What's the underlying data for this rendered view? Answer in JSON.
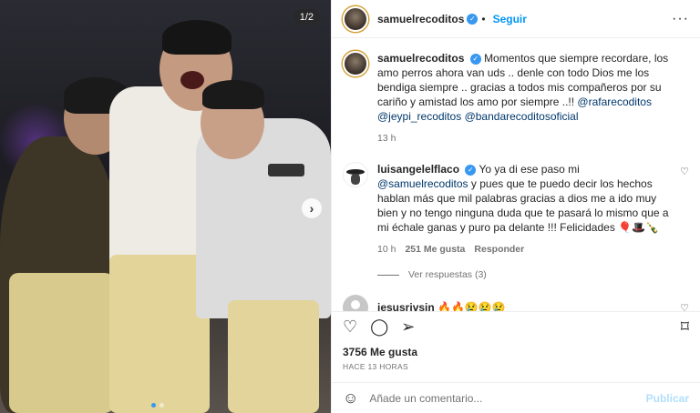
{
  "photo": {
    "counter": "1/2",
    "next_arrow": "›"
  },
  "header": {
    "username": "samuelrecoditos",
    "verified": "✓",
    "separator": "•",
    "follow": "Seguir",
    "more": "···"
  },
  "caption": {
    "username": "samuelrecoditos",
    "text": "Momentos que siempre recordare, los amo perros ahora van uds .. denle con todo Dios me los bendiga siempre .. gracias a todos mis compañeros por su cariño y amistad los amo por siempre ..!! ",
    "mentions": [
      "@rafarecoditos",
      "@jeypi_recoditos",
      "@bandarecoditosoficial"
    ],
    "time": "13 h"
  },
  "comments": [
    {
      "username": "luisangelelflaco",
      "text_a": "Yo ya di ese paso mi ",
      "mention": "@samuelrecoditos",
      "text_b": " y pues que te puedo decir los hechos hablan más que mil palabras gracias a dios me a ido muy bien y no tengo ninguna duda que te pasará lo mismo que a mi échale ganas y puro pa delante !!! Felicidades 🎈🎩🍾",
      "time": "10 h",
      "likes": "251 Me gusta",
      "reply": "Responder",
      "view_replies": "Ver respuestas (3)"
    },
    {
      "username": "jesusrivsin",
      "text": "🔥🔥😢😢😢"
    }
  ],
  "actions": {
    "like": "♡",
    "comment": "◯",
    "share": "➢",
    "save": "⌑"
  },
  "likes": "3756 Me gusta",
  "posted_ago": "HACE 13 HORAS",
  "add_comment": {
    "emoji": "☺",
    "placeholder": "Añade un comentario...",
    "post": "Publicar"
  },
  "colors": {
    "link": "#00376b",
    "accent": "#0095f6",
    "verified": "#3897f0"
  }
}
